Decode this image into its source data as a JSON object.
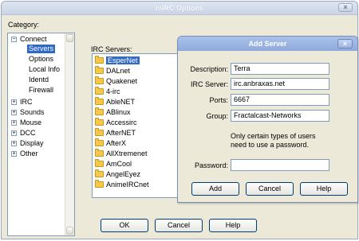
{
  "window": {
    "title": "mIRC Options",
    "close_glyph": "×"
  },
  "category_label": "Category:",
  "tree": {
    "items": [
      {
        "label": "Connect",
        "expander": "−"
      },
      {
        "label": "Servers",
        "selected": true
      },
      {
        "label": "Options"
      },
      {
        "label": "Local Info"
      },
      {
        "label": "Identd"
      },
      {
        "label": "Firewall"
      },
      {
        "label": "IRC",
        "expander": "+"
      },
      {
        "label": "Sounds",
        "expander": "+"
      },
      {
        "label": "Mouse",
        "expander": "+"
      },
      {
        "label": "DCC",
        "expander": "+"
      },
      {
        "label": "Display",
        "expander": "+"
      },
      {
        "label": "Other",
        "expander": "+"
      }
    ]
  },
  "servers_label": "IRC Servers:",
  "servers": [
    "EsperNet",
    "DALnet",
    "Quakenet",
    "4-irc",
    "AbleNET",
    "ABlinux",
    "Accessirc",
    "AfterNET",
    "AfterX",
    "AllXtremenet",
    "AmCool",
    "AngelEyez",
    "AnimeIRCnet"
  ],
  "selected_server": "EsperNet",
  "buttons": {
    "ok": "OK",
    "cancel": "Cancel",
    "help": "Help"
  },
  "dialog": {
    "title": "Add Server",
    "close_glyph": "×",
    "description_label": "Description:",
    "description_value": "Terra",
    "server_label": "IRC Server:",
    "server_value": "irc.anbraxas.net",
    "ports_label": "Ports:",
    "ports_value": "6667",
    "group_label": "Group:",
    "group_value": "Fractalcast-Networks",
    "note": "Only certain types of users need to use a password.",
    "password_label": "Password:",
    "password_value": "",
    "add": "Add",
    "cancel": "Cancel",
    "help": "Help"
  }
}
